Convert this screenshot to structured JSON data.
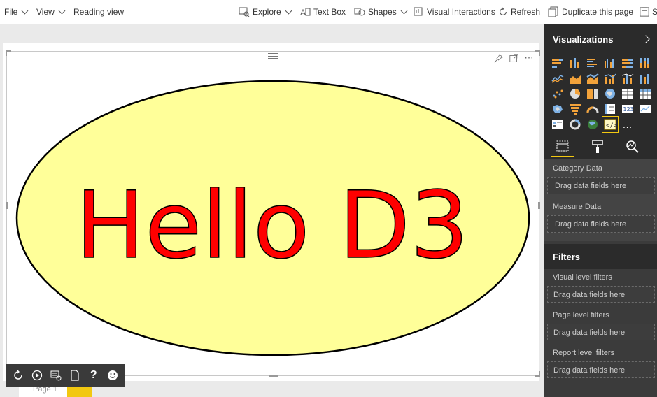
{
  "toolbar": {
    "file": "File",
    "view": "View",
    "reading_view": "Reading view",
    "explore": "Explore",
    "text_box": "Text Box",
    "shapes": "Shapes",
    "visual_interactions": "Visual Interactions",
    "refresh": "Refresh",
    "duplicate_page": "Duplicate this page",
    "save_partial": "S"
  },
  "visual": {
    "text": "Hello D3",
    "ellipse_fill": "#ffff99",
    "text_color": "#ff0000",
    "stroke_color": "#000000"
  },
  "pages": {
    "tab_label": "Page 1"
  },
  "panel": {
    "visualizations_title": "Visualizations",
    "more_icon": "...",
    "field_wells": [
      {
        "label": "Category Data",
        "placeholder": "Drag data fields here"
      },
      {
        "label": "Measure Data",
        "placeholder": "Drag data fields here"
      }
    ],
    "filters_title": "Filters",
    "filter_wells": [
      {
        "label": "Visual level filters",
        "placeholder": "Drag data fields here"
      },
      {
        "label": "Page level filters",
        "placeholder": "Drag data fields here"
      },
      {
        "label": "Report level filters",
        "placeholder": "Drag data fields here"
      }
    ]
  },
  "colors": {
    "accent": "#f2c811",
    "panel_bg": "#3b3b3b"
  }
}
